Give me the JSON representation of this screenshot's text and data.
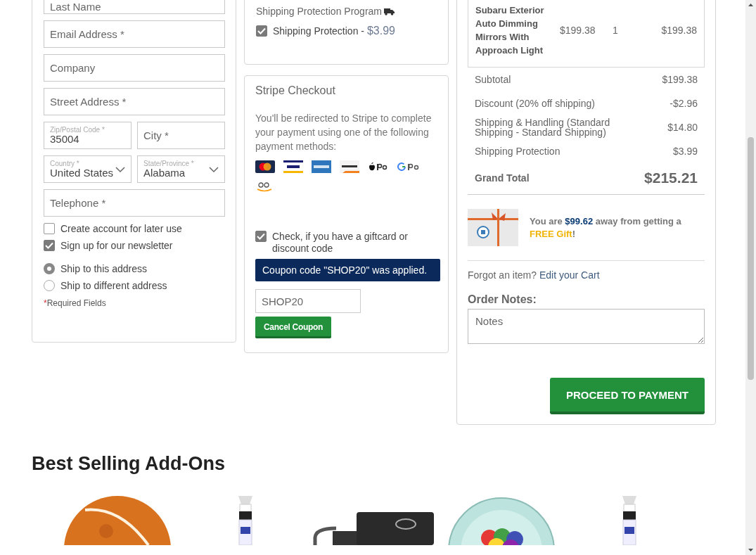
{
  "billing": {
    "rows": [
      [
        {
          "kind": "text",
          "placeholder": "Last Name"
        }
      ],
      [
        {
          "kind": "text",
          "placeholder": "Email Address *"
        }
      ],
      [
        {
          "kind": "text",
          "placeholder": "Company"
        }
      ],
      [
        {
          "kind": "text",
          "placeholder": "Street Address *"
        }
      ],
      [
        {
          "kind": "float",
          "label": "Zip/Postal Code *",
          "value": "35004"
        },
        {
          "kind": "text",
          "placeholder": "City *"
        }
      ],
      [
        {
          "kind": "select",
          "label": "Country *",
          "value": "United States"
        },
        {
          "kind": "select",
          "label": "State/Province *",
          "value": "Alabama"
        }
      ],
      [
        {
          "kind": "text",
          "placeholder": "Telephone *"
        }
      ]
    ],
    "checkboxes": [
      {
        "label": "Create account for later use",
        "checked": false
      },
      {
        "label": "Sign up for our newsletter",
        "checked": true
      }
    ],
    "ship_options": [
      {
        "label": "Ship to this address",
        "selected": true
      },
      {
        "label": "Ship to different address",
        "selected": false
      }
    ],
    "required_note": {
      "mark": "*",
      "text": "Required Fields"
    }
  },
  "shipping_protection": {
    "title": "Shipping Protection Program",
    "label": "Shipping Protection - ",
    "price": "$3.99",
    "checked": true
  },
  "stripe": {
    "title": "Stripe Checkout",
    "description": "You'll be redirected to Stripe to complete your payment using one of the following payment methods:",
    "coupon": {
      "label": "Check, if you have a giftcard or discount code",
      "checked": true,
      "message": "Coupon code \"SHOP20\" was applied.",
      "code": "SHOP20",
      "button": "Cancel Coupon"
    }
  },
  "order": {
    "item": {
      "name": "Subaru Exterior Auto Dimming Mirrors With Approach Light",
      "price": "$199.38",
      "qty": "1",
      "total": "$199.38"
    },
    "totals": [
      {
        "label": "Subtotal",
        "value": "$199.38"
      },
      {
        "label": "Discount (20% off shipping)",
        "value": "-$2.96"
      },
      {
        "label": "Shipping & Handling (Standard Shipping - Standard Shipping)",
        "value": "$14.80"
      },
      {
        "label": "Shipping Protection",
        "value": "$3.99"
      }
    ],
    "grand_total": {
      "label": "Grand Total",
      "value": "$215.21"
    },
    "gift": {
      "before": "You are ",
      "amount": "$99.62",
      "middle": " away from getting a ",
      "highlight": "FREE Gift",
      "after": "!"
    },
    "forgot": {
      "text": "Forgot an item?",
      "link": "Edit your Cart"
    },
    "notes": {
      "label": "Order Notes:",
      "placeholder": "Notes"
    },
    "button": "PROCEED TO PAYMENT"
  },
  "addons": {
    "title": "Best Selling Add-Ons"
  }
}
